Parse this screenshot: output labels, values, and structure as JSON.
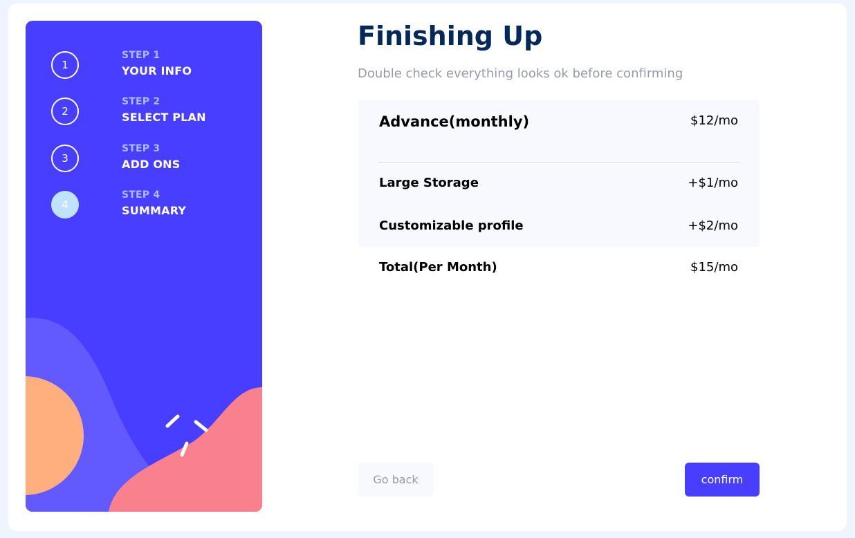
{
  "colors": {
    "sidebar": "#483eff",
    "accent": "#483eff",
    "title": "#02295a",
    "muted": "#9699ab",
    "active_step": "#bfe2fd",
    "wave_purple": "#6259ff",
    "circle_orange": "#ffaf7e",
    "blob_pink": "#f9818e"
  },
  "sidebar": {
    "steps": [
      {
        "number": "1",
        "sub": "STEP 1",
        "title": "YOUR INFO",
        "active": false
      },
      {
        "number": "2",
        "sub": "STEP 2",
        "title": "SELECT PLAN",
        "active": false
      },
      {
        "number": "3",
        "sub": "STEP 3",
        "title": "ADD ONS",
        "active": false
      },
      {
        "number": "4",
        "sub": "STEP 4",
        "title": "SUMMARY",
        "active": true
      }
    ]
  },
  "main": {
    "title": "Finishing Up",
    "subtitle": "Double check everything looks ok before confirming",
    "plan": {
      "name": "Advance(monthly)",
      "price": "$12/mo"
    },
    "addons": [
      {
        "name": "Large Storage",
        "price": "+$1/mo"
      },
      {
        "name": "Customizable profile",
        "price": "+$2/mo"
      }
    ],
    "total": {
      "label": "Total(Per Month)",
      "price": "$15/mo"
    }
  },
  "buttons": {
    "back": "Go back",
    "confirm": "confirm"
  }
}
